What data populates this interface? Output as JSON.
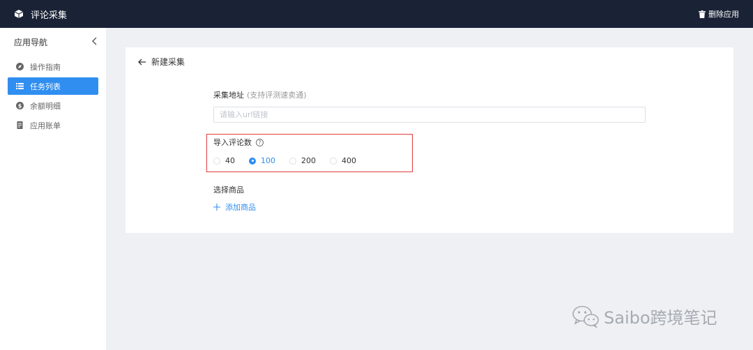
{
  "header": {
    "title": "评论采集",
    "delete_label": "删除应用"
  },
  "sidebar": {
    "heading": "应用导航",
    "items": [
      {
        "label": "操作指南",
        "icon": "compass-icon"
      },
      {
        "label": "任务列表",
        "icon": "list-icon",
        "active": true
      },
      {
        "label": "余额明细",
        "icon": "dollar-icon"
      },
      {
        "label": "应用账单",
        "icon": "bill-icon"
      }
    ]
  },
  "page": {
    "back_title": "新建采集",
    "url": {
      "label": "采集地址",
      "hint": "(支持评测速卖通)",
      "placeholder": "请输入url链接",
      "value": ""
    },
    "count": {
      "label": "导入评论数",
      "options": [
        "40",
        "100",
        "200",
        "400"
      ],
      "selected": "100"
    },
    "product": {
      "label": "选择商品",
      "add_label": "添加商品"
    }
  },
  "watermark": {
    "text": "Saibo跨境笔记"
  },
  "colors": {
    "topbar": "#1a2236",
    "accent": "#2f8ef0",
    "highlight": "#e03a3a"
  }
}
